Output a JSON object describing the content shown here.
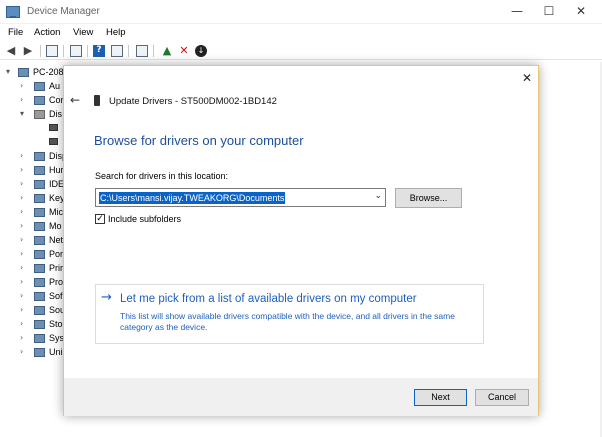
{
  "window": {
    "title": "Device Manager",
    "controls": {
      "minimize": "—",
      "maximize": "☐",
      "close": "✕"
    }
  },
  "menu": {
    "file": "File",
    "action": "Action",
    "view": "View",
    "help": "Help"
  },
  "toolbar": {
    "icons": [
      "back-arrow-icon",
      "forward-arrow-icon",
      "properties-icon",
      "help-icon",
      "update-driver-icon",
      "scan-hardware-icon",
      "uninstall-icon",
      "disable-icon"
    ]
  },
  "tree": {
    "root": "PC-208",
    "items": [
      "Au",
      "Cor",
      "Dis",
      "",
      "",
      "Disp",
      "Hur",
      "IDE",
      "Key",
      "Mic",
      "Mo",
      "Net",
      "Por",
      "Prir",
      "Pro",
      "Sof",
      "Sou",
      "Sto",
      "Syst",
      "Uni"
    ]
  },
  "dialog": {
    "close": "✕",
    "back": "←",
    "heading": "Update Drivers - ST500DM002-1BD142",
    "subtitle": "Browse for drivers on your computer",
    "search_label": "Search for drivers in this location:",
    "path_value": "C:\\Users\\mansi.vijay.TWEAKORG\\Documents",
    "browse_label": "Browse...",
    "include_subfolders_label": "Include subfolders",
    "include_subfolders_checked": true,
    "pick_title": "Let me pick from a list of available drivers on my computer",
    "pick_description": "This list will show available drivers compatible with the device, and all drivers in the same category as the device.",
    "next_label": "Next",
    "cancel_label": "Cancel"
  },
  "colors": {
    "accent": "#1e5fc0",
    "heading_blue": "#1e4e99",
    "selection": "#0a64c8",
    "dialog_border": "#e8c46a"
  }
}
